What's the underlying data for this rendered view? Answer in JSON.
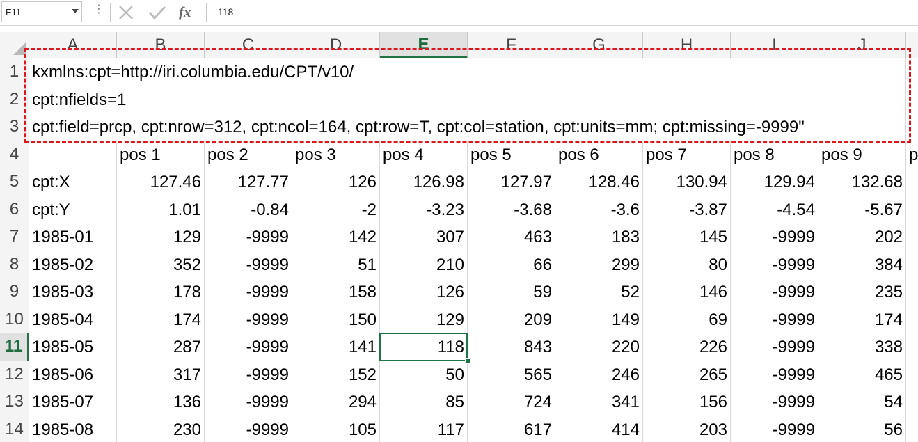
{
  "name_box": {
    "value": "E11"
  },
  "formula_bar": {
    "dots": "⋮",
    "fx_label": "fx",
    "value": "118"
  },
  "columns": [
    "A",
    "B",
    "C",
    "D",
    "E",
    "F",
    "G",
    "H",
    "I",
    "J"
  ],
  "selected_column": "E",
  "selected_row": "11",
  "colors": {
    "accent": "#217346",
    "highlight": "#d9171c"
  },
  "rows": [
    {
      "num": "1",
      "cells": [
        "kxmlns:cpt=http://iri.columbia.edu/CPT/v10/"
      ]
    },
    {
      "num": "2",
      "cells": [
        "cpt:nfields=1"
      ]
    },
    {
      "num": "3",
      "cells": [
        "cpt:field=prcp, cpt:nrow=312, cpt:ncol=164, cpt:row=T, cpt:col=station, cpt:units=mm; cpt:missing=-9999\""
      ]
    },
    {
      "num": "4",
      "cells": [
        "",
        "pos 1",
        "pos 2",
        "pos 3",
        "pos 4",
        "pos 5",
        "pos 6",
        "pos 7",
        "pos 8",
        "pos 9",
        "p"
      ]
    },
    {
      "num": "5",
      "cells": [
        "cpt:X",
        "127.46",
        "127.77",
        "126",
        "126.98",
        "127.97",
        "128.46",
        "130.94",
        "129.94",
        "132.68"
      ]
    },
    {
      "num": "6",
      "cells": [
        "cpt:Y",
        "1.01",
        "-0.84",
        "-2",
        "-3.23",
        "-3.68",
        "-3.6",
        "-3.87",
        "-4.54",
        "-5.67"
      ]
    },
    {
      "num": "7",
      "cells": [
        "1985-01",
        "129",
        "-9999",
        "142",
        "307",
        "463",
        "183",
        "145",
        "-9999",
        "202"
      ]
    },
    {
      "num": "8",
      "cells": [
        "1985-02",
        "352",
        "-9999",
        "51",
        "210",
        "66",
        "299",
        "80",
        "-9999",
        "384"
      ]
    },
    {
      "num": "9",
      "cells": [
        "1985-03",
        "178",
        "-9999",
        "158",
        "126",
        "59",
        "52",
        "146",
        "-9999",
        "235"
      ]
    },
    {
      "num": "10",
      "cells": [
        "1985-04",
        "174",
        "-9999",
        "150",
        "129",
        "209",
        "149",
        "69",
        "-9999",
        "174"
      ]
    },
    {
      "num": "11",
      "cells": [
        "1985-05",
        "287",
        "-9999",
        "141",
        "118",
        "843",
        "220",
        "226",
        "-9999",
        "338"
      ]
    },
    {
      "num": "12",
      "cells": [
        "1985-06",
        "317",
        "-9999",
        "152",
        "50",
        "565",
        "246",
        "265",
        "-9999",
        "465"
      ]
    },
    {
      "num": "13",
      "cells": [
        "1985-07",
        "136",
        "-9999",
        "294",
        "85",
        "724",
        "341",
        "156",
        "-9999",
        "54"
      ]
    },
    {
      "num": "14",
      "cells": [
        "1985-08",
        "230",
        "-9999",
        "105",
        "117",
        "617",
        "414",
        "203",
        "-9999",
        "56"
      ]
    }
  ]
}
